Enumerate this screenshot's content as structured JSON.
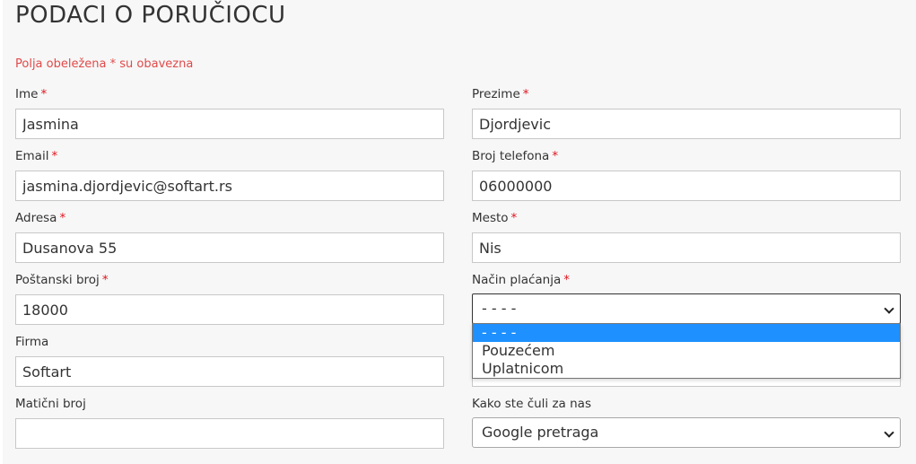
{
  "title": "PODACI O PORUČIOCU",
  "required_note": "Polja obeležena * su obavezna",
  "required_marker": "*",
  "fields": {
    "ime": {
      "label": "Ime",
      "value": "Jasmina"
    },
    "prezime": {
      "label": "Prezime",
      "value": "Djordjevic"
    },
    "email": {
      "label": "Email",
      "value": "jasmina.djordjevic@softart.rs"
    },
    "telefon": {
      "label": "Broj telefona",
      "value": "06000000"
    },
    "adresa": {
      "label": "Adresa",
      "value": "Dusanova 55"
    },
    "mesto": {
      "label": "Mesto",
      "value": "Nis"
    },
    "postanski": {
      "label": "Poštanski broj",
      "value": "18000"
    },
    "placanje": {
      "label": "Način plaćanja",
      "value": "- - - -"
    },
    "firma": {
      "label": "Firma",
      "value": "Softart"
    },
    "maticni": {
      "label": "Matični broj",
      "value": ""
    },
    "kako": {
      "label": "Kako ste čuli za nas",
      "value": "Google pretraga"
    }
  },
  "payment_options": [
    "- - - -",
    "Pouzećem",
    "Uplatnicom"
  ],
  "colors": {
    "panel_bg": "#f7f7f7",
    "required_note": "#e04a4a",
    "star": "#e0141e",
    "option_highlight": "#1e90ff"
  },
  "icons": {
    "select_arrow": "chevron-down-icon"
  }
}
